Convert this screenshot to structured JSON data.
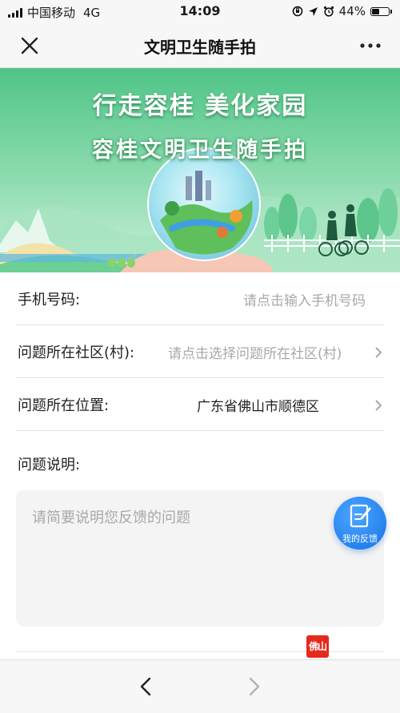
{
  "status_bar": {
    "carrier": "中国移动",
    "network": "4G",
    "time": "14:09",
    "battery_percent": "44%",
    "battery_level": 0.44
  },
  "nav": {
    "title": "文明卫生随手拍",
    "close_icon": "close-icon",
    "more_icon": "more-dots-icon"
  },
  "banner": {
    "line1": "行走容桂 美化家园",
    "line2": "容桂文明卫生随手拍"
  },
  "form": {
    "phone": {
      "label": "手机号码:",
      "placeholder": "请点击输入手机号码"
    },
    "community": {
      "label": "问题所在社区(村):",
      "placeholder": "请点击选择问题所在社区(村)"
    },
    "location": {
      "label": "问题所在位置:",
      "value": "广东省佛山市顺德区"
    },
    "description": {
      "label": "问题说明:",
      "placeholder": "请简要说明您反馈的问题"
    }
  },
  "fab": {
    "label": "我的反馈",
    "icon": "edit-note-icon",
    "color": "#1f7ff0"
  },
  "watermark": {
    "text": "佛山"
  },
  "toolbar": {
    "back_icon": "chevron-left-icon",
    "forward_icon": "chevron-right-icon"
  },
  "colors": {
    "bar_background": "#f7f7f7",
    "placeholder": "#a8a8a8",
    "text": "#1f1f1f",
    "banner_green": "#5fcf8e"
  }
}
